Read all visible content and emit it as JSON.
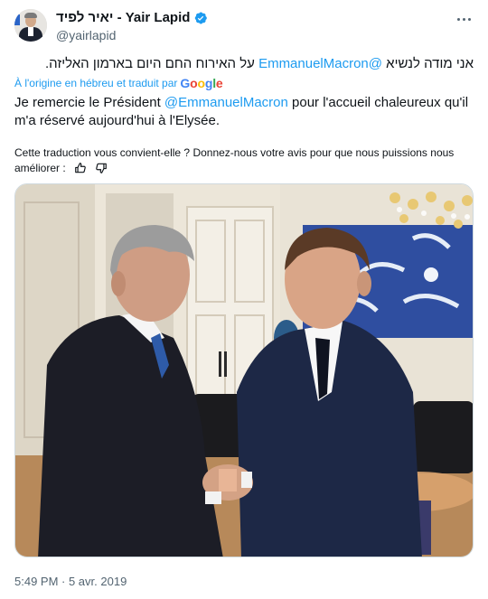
{
  "author": {
    "display_name": "יאיר לפיד - Yair Lapid",
    "handle": "@yairlapid",
    "verified": true,
    "avatar_icon": "avatar-portrait"
  },
  "tweet": {
    "hebrew_before": "אני מודה לנשיא ",
    "hebrew_mention": "@EmmanuelMacron",
    "hebrew_after": " על האירוח החם היום בארמון האליזה.",
    "translation_note": "À l'origine en hébreu et traduit par",
    "translation_provider": "Google",
    "translation_before": "Je remercie le Président ",
    "translation_mention": "@EmmanuelMacron",
    "translation_after": " pour l'accueil chaleureux qu'il m'a réservé aujourd'hui à l'Elysée.",
    "feedback_prompt": "Cette traduction vous convient-elle ? Donnez-nous votre avis pour que nous puissions nous améliorer :",
    "timestamp": "5:49 PM · 5 avr. 2019"
  },
  "colors": {
    "link": "#1d9bf0",
    "secondary_text": "#536471",
    "verified_badge": "#1d9bf0"
  },
  "icons": {
    "more": "more-horizontal-icon",
    "verified": "verified-badge-icon",
    "thumbs_up": "thumbs-up-icon",
    "thumbs_down": "thumbs-down-icon"
  }
}
